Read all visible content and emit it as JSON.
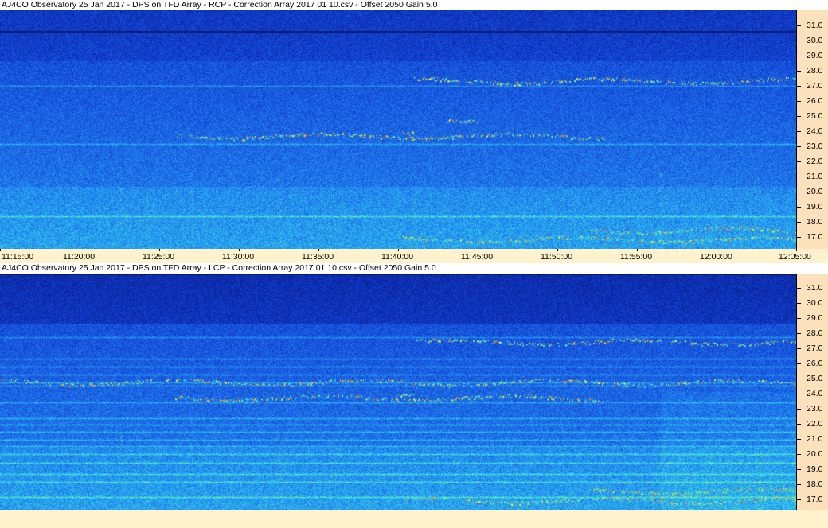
{
  "panels": [
    {
      "title": "AJ4CO Observatory 25 Jan 2017  -  DPS on TFD Array  -  RCP  -  Correction Array 2017 01 10.csv  -  Offset 2050  Gain 5.0",
      "polarization": "RCP"
    },
    {
      "title": "AJ4CO Observatory 25 Jan 2017  -  DPS on TFD Array  -  LCP  -  Correction Array 2017 01 10.csv  -  Offset 2050  Gain 5.0",
      "polarization": "LCP"
    }
  ],
  "x_tick_labels": [
    "11:15:00",
    "11:20:00",
    "11:25:00",
    "11:30:00",
    "11:35:00",
    "11:40:00",
    "11:45:00",
    "11:50:00",
    "11:55:00",
    "12:00:00",
    "12:05:00"
  ],
  "y_tick_labels": [
    "31.0",
    "30.0",
    "29.0",
    "28.0",
    "27.0",
    "26.0",
    "25.0",
    "24.0",
    "23.0",
    "22.0",
    "21.0",
    "20.0",
    "19.0",
    "18.0",
    "17.0"
  ],
  "colors": {
    "background_low": "#0a2a9a",
    "background_mid": "#1f62e0",
    "signal_cyan": "#3fe0e0",
    "signal_yellow": "#f0f040",
    "signal_red": "#e04020",
    "axis_panel": "#fde1bd",
    "time_axis": "#fff2cc"
  },
  "chart_data": [
    {
      "type": "heatmap",
      "title": "AJ4CO Observatory 25 Jan 2017  -  DPS on TFD Array  -  RCP  -  Correction Array 2017 01 10.csv  -  Offset 2050  Gain 5.0",
      "xlabel": "",
      "ylabel": "",
      "x_range": [
        "11:15:00",
        "12:05:00"
      ],
      "y_range_mhz": [
        16.6,
        31.8
      ],
      "grid": false,
      "features": [
        {
          "time_start": "11:26",
          "time_end": "11:53",
          "freq_mhz": 23.8
        },
        {
          "time_start": "11:40",
          "time_end": "11:41",
          "freq_mhz": 24.1
        },
        {
          "time_start": "11:43",
          "time_end": "11:45",
          "freq_mhz": 24.6
        },
        {
          "time_start": "11:41",
          "time_end": "12:05",
          "freq_mhz": 27.3
        },
        {
          "time_start": "11:40",
          "time_end": "12:05",
          "freq_mhz": 17.2
        },
        {
          "time_start": "11:52",
          "time_end": "12:05",
          "freq_mhz": 17.8
        }
      ]
    },
    {
      "type": "heatmap",
      "title": "AJ4CO Observatory 25 Jan 2017  -  DPS on TFD Array  -  LCP  -  Correction Array 2017 01 10.csv  -  Offset 2050  Gain 5.0",
      "xlabel": "",
      "ylabel": "",
      "x_range": [
        "11:15:00",
        "12:05:00"
      ],
      "y_range_mhz": [
        16.6,
        31.8
      ],
      "grid": false,
      "features": [
        {
          "time_start": "11:26",
          "time_end": "11:53",
          "freq_mhz": 23.8
        },
        {
          "time_start": "11:40",
          "time_end": "11:41",
          "freq_mhz": 24.1
        },
        {
          "time_start": "11:41",
          "time_end": "12:05",
          "freq_mhz": 27.4
        },
        {
          "time_start": "11:40",
          "time_end": "12:05",
          "freq_mhz": 17.2
        },
        {
          "time_start": "11:52",
          "time_end": "12:05",
          "freq_mhz": 17.8
        },
        {
          "time_start": "11:15",
          "time_end": "12:05",
          "freq_mhz": 24.8
        }
      ]
    }
  ]
}
